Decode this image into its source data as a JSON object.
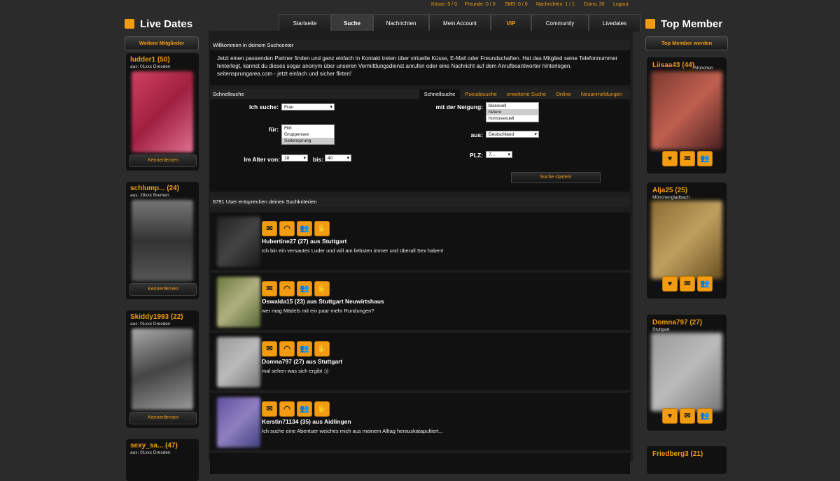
{
  "top_stats": {
    "kusse": "Küsse: 0 / 0",
    "freunde": "Freunde: 0 / 0",
    "sms": "SMS: 0 / 0",
    "nachrichten": "Nachrichten: 1 / 1",
    "coins": "Coins: 30",
    "logout": "Logout"
  },
  "nav_tabs": [
    "Startseite",
    "Suche",
    "Nachrichten",
    "Mein Account",
    "VIP",
    "Community",
    "Livedates"
  ],
  "left_sidebar": {
    "title": "Live Dates",
    "more_button": "Weitere Mitglieder",
    "cards": [
      {
        "name": "ludder1 (50)",
        "from": "aus: 01xxx Dresden",
        "button": "Kennenlernen"
      },
      {
        "name": "schlump... (24)",
        "from": "aus: 28xxx Bremen",
        "button": "Kennenlernen"
      },
      {
        "name": "Skiddy1993 (22)",
        "from": "aus: 01xxx Dresden",
        "button": "Kennenlernen"
      },
      {
        "name": "sexy_sa... (47)",
        "from": "aus: 01xxx Dresden",
        "button": ""
      }
    ]
  },
  "right_sidebar": {
    "title": "Top Member",
    "button": "Top Member werden",
    "cards": [
      {
        "name": "Liisaa43 (44)",
        "from": "München"
      },
      {
        "name": "Alja25 (25)",
        "from": "Mönchengladbach"
      },
      {
        "name": "Domna797 (27)",
        "from": "Stuttgart"
      },
      {
        "name": "Friedberg3 (21)",
        "from": ""
      }
    ]
  },
  "welcome": {
    "header": "Willkommen in deinem Suchcenter",
    "text": "Jetzt einen passenden Partner finden und ganz einfach in Kontakt treten über virtuelle Küsse, E-Mail oder Freundschaften. Hat das Mitglied seine Telefonnummer hinterlegt, kannst du dieses sogar anonym über unseren Vermittlungsdienst anrufen oder eine Nachricht auf dem Anrufbeantworter hinterlegen. seitensprungarea.com - jetzt einfach und sicher flirten!"
  },
  "search": {
    "header": "Schnellsuche",
    "subtabs": [
      "Schnellsuche",
      "Pseudosuche",
      "erweiterte Suche",
      "Online",
      "Neuanmeldungen"
    ],
    "ich_suche_label": "Ich suche:",
    "ich_suche_value": "Frau",
    "fuer_label": "für:",
    "fuer_options": [
      "Flirt",
      "Gruppensex",
      "Seitensprung"
    ],
    "alter_label": "Im Alter von:",
    "alter_von": "18",
    "bis_label": "bis:",
    "alter_bis": "40",
    "neigung_label": "mit der Neigung:",
    "neigung_options": [
      "bisexuell",
      "hetero",
      "homosexuell"
    ],
    "aus_label": "aus:",
    "aus_value": "Deutschland",
    "plz_label": "PLZ:",
    "plz_value": "7...",
    "start_button": "Suche starten!"
  },
  "results_header": "6791 User entsprechen deinen Suchkriterien",
  "results": [
    {
      "title": "Hubertine27 (27) aus Stuttgart",
      "desc": "Ich bin ein versautes Luder und will am liebsten immer und überall Sex haben!"
    },
    {
      "title": "Oswalda15 (23) aus Stuttgart Neuwirtshaus",
      "desc": "wer mag Mädels mit ein paar mehr Rundungen?"
    },
    {
      "title": "Domna797 (27) aus Stuttgart",
      "desc": "mal sehen was sich ergibt :))"
    },
    {
      "title": "Kerstin71134 (35) aus Aidlingen",
      "desc": "Ich suche eine Abentuer weiches mich aus meinem Alltag herauskatapultiert..."
    }
  ],
  "colors": {
    "accent": "#f39c12",
    "background": "#2b2b2b",
    "panel": "#111111"
  },
  "icons": [
    "mail-icon",
    "lips-icon",
    "friends-icon",
    "hand-icon",
    "heart-icon",
    "crown-icon",
    "calendar-icon"
  ]
}
